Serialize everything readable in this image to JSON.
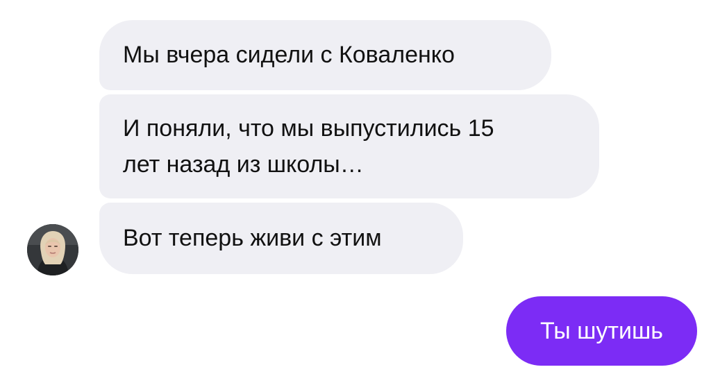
{
  "messages": {
    "incoming": [
      {
        "lines": [
          "Мы вчера сидели с Коваленко"
        ]
      },
      {
        "lines": [
          "И поняли, что мы выпустились 15",
          "лет назад из школы…"
        ]
      },
      {
        "lines": [
          "Вот теперь живи с этим"
        ]
      }
    ],
    "outgoing": [
      {
        "lines": [
          "Ты шутишь"
        ]
      }
    ]
  },
  "colors": {
    "incoming_bubble": "#efeff4",
    "outgoing_bubble": "#7c2cf5",
    "outgoing_text": "#ffffff"
  },
  "icons": {
    "sender_avatar": "avatar-photo"
  }
}
